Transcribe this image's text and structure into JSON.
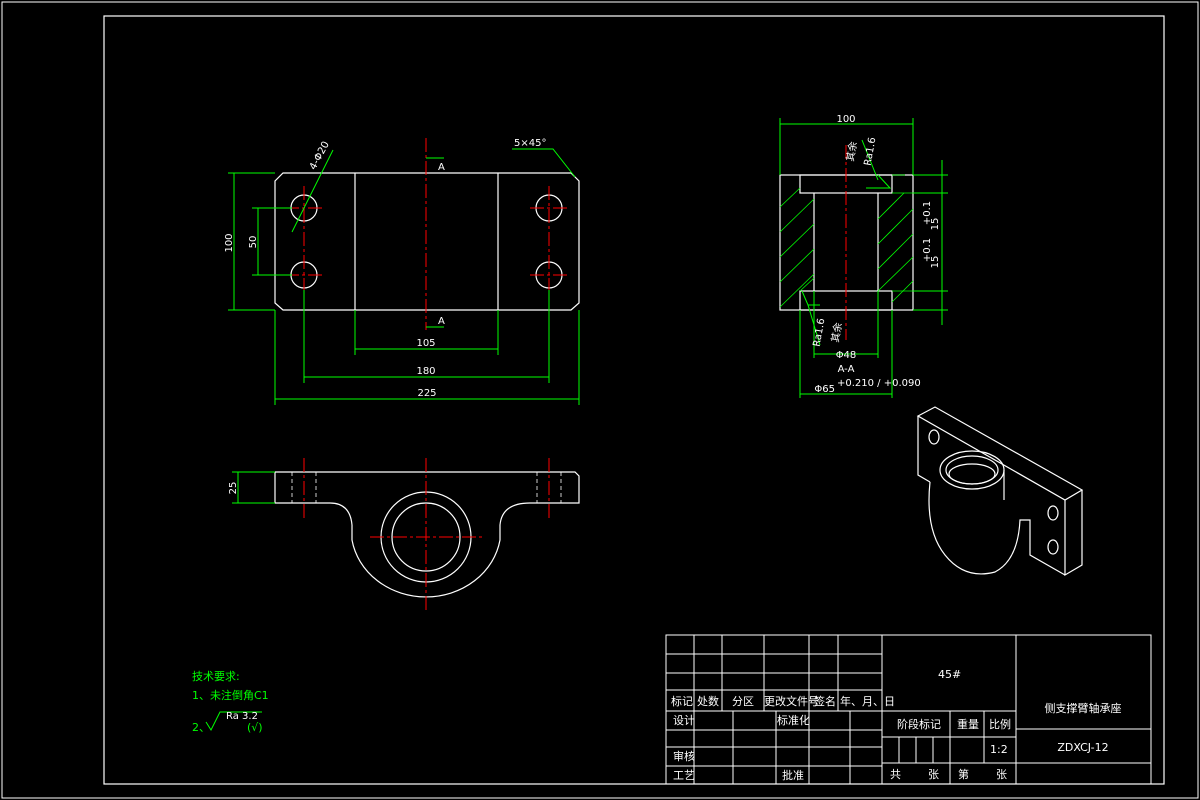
{
  "drawing": {
    "dimensions": {
      "overall_length": "225",
      "hole_spacing": "180",
      "center_width": "105",
      "height": "100",
      "hole_vertical": "50",
      "hole_dia": "4-Φ20",
      "chamfer": "5×45°",
      "section_mark": "A",
      "thickness": "25",
      "side_width": "100",
      "bore_inner": "Φ48",
      "bore_outer": "Φ65",
      "bore_tol": "+0.210 / +0.090",
      "roughness_top": "Ra1.6",
      "roughness_bottom": "Ra1.6",
      "finish_word": "其余",
      "depth_top": "15",
      "depth_top_tol": "+0.1",
      "depth_bottom": "15",
      "depth_bottom_tol": "+0.1",
      "section_label": "A-A"
    },
    "notes": {
      "title": "技术要求:",
      "item1": "1、未注倒角C1",
      "item2_prefix": "2、",
      "item2_ra": "Ra 3.2",
      "item2_suffix": "(√)"
    },
    "title_block": {
      "material": "45#",
      "part_name": "侧支撑臂轴承座",
      "drawing_no": "ZDXCJ-12",
      "scale": "1:2",
      "labels": {
        "mark": "标记",
        "count": "处数",
        "zone": "分区",
        "change_doc": "更改文件号",
        "sign": "签名",
        "date": "年、月、日",
        "design": "设计",
        "standard": "标准化",
        "stage_mark": "阶段标记",
        "weight": "重量",
        "ratio": "比例",
        "review": "审核",
        "process": "工艺",
        "approve": "批准",
        "total": "共",
        "sheet": "张",
        "page": "第",
        "sheet2": "张"
      }
    }
  }
}
